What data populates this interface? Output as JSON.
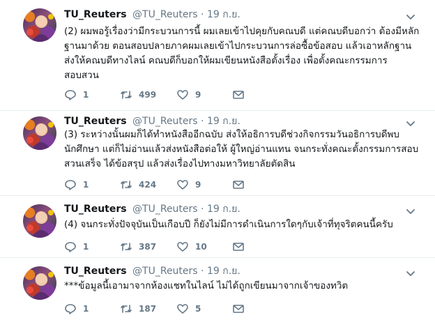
{
  "tweets": [
    {
      "name": "TU_Reuters",
      "handle": "@TU_Reuters",
      "sep": "·",
      "time": "19 ก.ย.",
      "lines": [
        "(2) ผมพอรู้เรื่องว่ามีกระบวนการนี้ ผมเลยเข้าไปคุยกับคณบดี แต่คณบดีบอกว่า ต้องมีหลัก",
        "ฐานมาด้วย ตอนสอบปลายภาคผมเลยเข้าไปกระบวนการล่อซื้อข้อสอบ แล้วเอาหลักฐาน",
        "ส่งให้คณบดีทางไลน์ คณบดีก็บอกให้ผมเขียนหนังสือตั้งเรื่อง เพื่อตั้งคณะกรรมการ",
        "สอบสวน"
      ],
      "replies": "1",
      "retweets": "499",
      "likes": "9"
    },
    {
      "name": "TU_Reuters",
      "handle": "@TU_Reuters",
      "sep": "·",
      "time": "19 ก.ย.",
      "lines": [
        "(3) ระหว่างนั้นผมก็ได้ทำหนังสืออีกฉบับ ส่งให้อธิการบดีช่วงกิจกรรมวันอธิการบดีพบ",
        "นักศึกษา แต่ก็ไม่อ่านแล้วส่งหนังสือต่อให้ ผู้ใหญ่อ่านแทน จนกระทั่งคณะตั้งกรรมการสอบ",
        "สวนเสร็จ ได้ข้อสรุป แล้วส่งเรื่องไปทางมหาวิทยาลัยตัดสิน"
      ],
      "replies": "1",
      "retweets": "424",
      "likes": "9"
    },
    {
      "name": "TU_Reuters",
      "handle": "@TU_Reuters",
      "sep": "·",
      "time": "19 ก.ย.",
      "lines": [
        "(4) จนกระทั่งปัจจุบันเป็นเกือบปี ก็ยังไม่มีการดำเนินการใดๆกับเจ้าที่ทุจริตคนนี้ครับ"
      ],
      "replies": "1",
      "retweets": "387",
      "likes": "10"
    },
    {
      "name": "TU_Reuters",
      "handle": "@TU_Reuters",
      "sep": "·",
      "time": "19 ก.ย.",
      "lines": [
        "***ข้อมูลนี้เอามาจากห้องแชทในไลน์ ไม่ได้ถูกเขียนมาจากเจ้าของทวิต"
      ],
      "replies": "1",
      "retweets": "187",
      "likes": "5"
    }
  ],
  "icons": {
    "reply": "reply-icon",
    "retweet": "retweet-icon",
    "like": "heart-icon",
    "dm": "envelope-icon",
    "menu": "chevron-down-icon"
  },
  "colors": {
    "muted": "#657786",
    "text": "#14171a",
    "divider": "#e6ecf0"
  }
}
